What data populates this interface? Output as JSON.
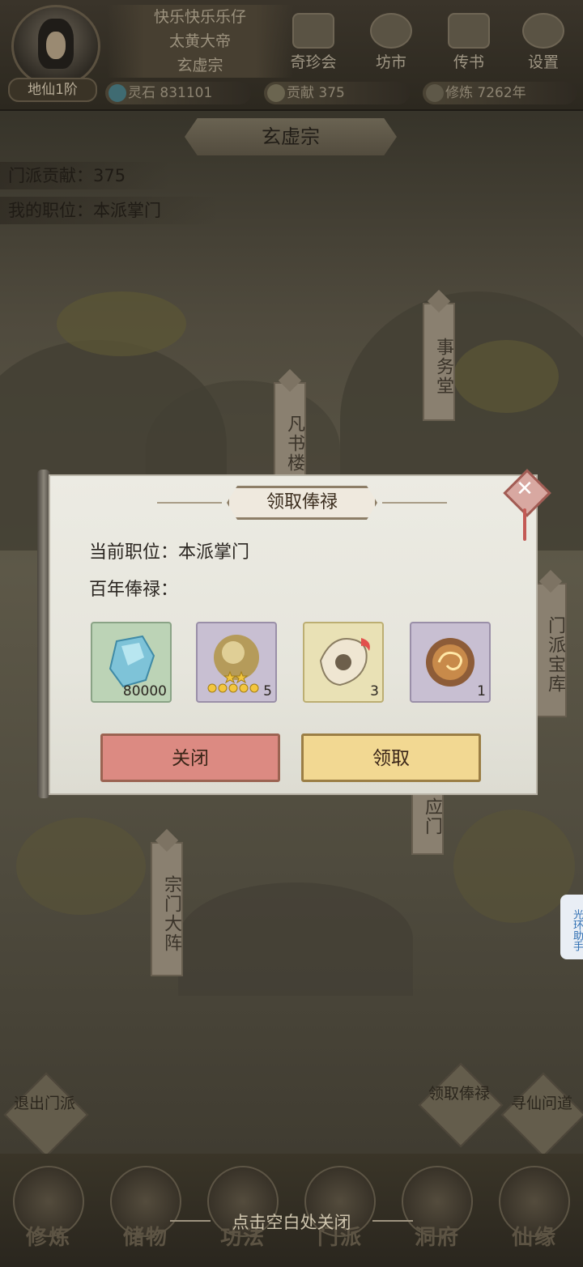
{
  "header": {
    "player_name": "快乐快乐乐仔",
    "title": "太黄大帝",
    "sect": "玄虚宗",
    "realm": "地仙1阶",
    "nav": [
      "奇珍会",
      "坊市",
      "传书",
      "设置"
    ],
    "resources": {
      "spirit_stone_label": "灵石",
      "spirit_stone": "831101",
      "contribution_label": "贡献",
      "contribution": "375",
      "cultivation_label": "修炼",
      "cultivation": "7262年"
    }
  },
  "sect_page": {
    "title": "玄虚宗",
    "contribution": "门派贡献：375",
    "position": "我的职位：本派掌门",
    "banners": {
      "affairs": "事务堂",
      "library": "凡书楼",
      "treasury": "门派宝库",
      "gate": "应门",
      "formation": "宗门大阵"
    },
    "actions": {
      "leave": "退出门派",
      "salary": "领取俸禄",
      "seek": "寻仙问道"
    }
  },
  "dialog": {
    "title": "领取俸禄",
    "position_line": "当前职位：本派掌门",
    "reward_label": "百年俸禄：",
    "items": [
      {
        "icon": "blue-crystal-icon",
        "count": "80000"
      },
      {
        "icon": "golden-orb-icon",
        "count": "5",
        "stars": 5
      },
      {
        "icon": "jade-talisman-icon",
        "count": "3"
      },
      {
        "icon": "swirl-orb-icon",
        "count": "1"
      }
    ],
    "close_label": "关闭",
    "claim_label": "领取"
  },
  "bottom_nav": [
    "修炼",
    "储物",
    "功法",
    "门派",
    "洞府",
    "仙缘"
  ],
  "hint": "点击空白处关闭",
  "helper": "光环助手",
  "colors": {
    "close_button": "#dc8a82",
    "claim_button": "#f2d892",
    "paper": "#ecebe3"
  }
}
